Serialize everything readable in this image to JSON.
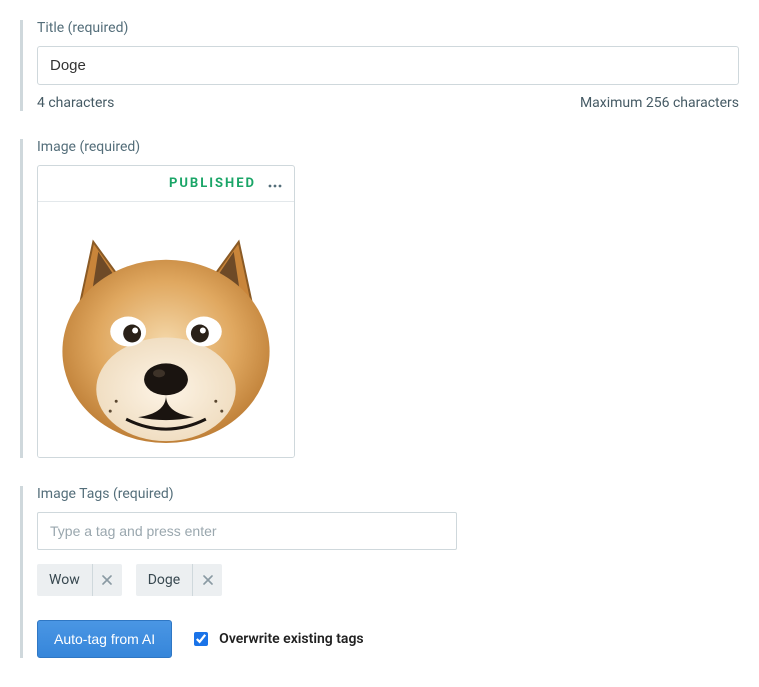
{
  "title_field": {
    "label": "Title (required)",
    "value": "Doge",
    "char_count": "4 characters",
    "max_chars": "Maximum 256 characters"
  },
  "image_field": {
    "label": "Image (required)",
    "status": "PUBLISHED"
  },
  "tags_field": {
    "label": "Image Tags (required)",
    "placeholder": "Type a tag and press enter",
    "tags": [
      "Wow",
      "Doge"
    ]
  },
  "actions": {
    "auto_tag_label": "Auto-tag from AI",
    "overwrite_label": "Overwrite existing tags",
    "overwrite_checked": true
  }
}
